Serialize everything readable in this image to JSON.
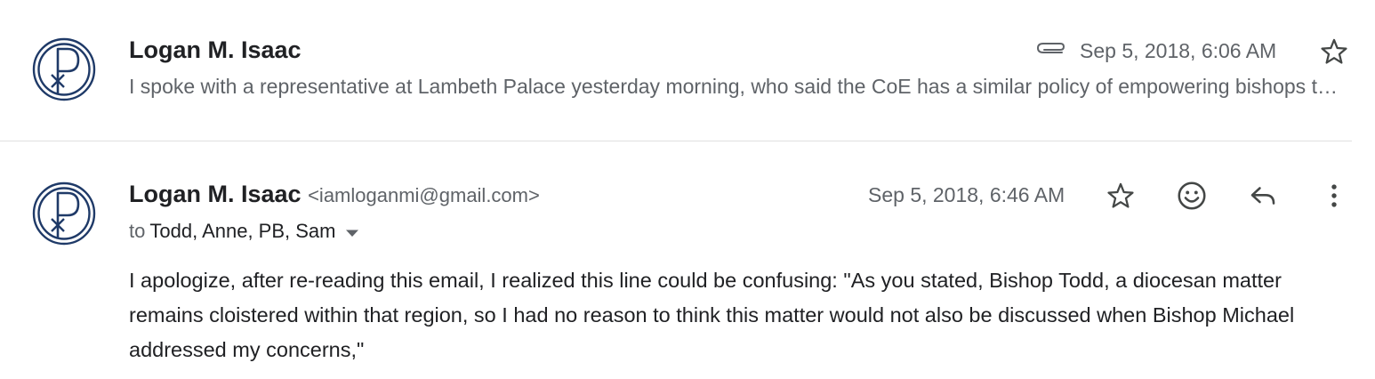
{
  "colors": {
    "avatar_stroke": "#1f3a68",
    "icon": "#5f6368",
    "icon_dark": "#444746"
  },
  "messages": [
    {
      "sender_name": "Logan M. Isaac",
      "snippet": "I spoke with a representative at Lambeth Palace yesterday morning, who said the CoE has a similar policy of empowering bishops to adjudicate matters within their own dioceses",
      "has_attachment": true,
      "date": "Sep 5, 2018, 6:06 AM",
      "icons": [
        "paperclip-icon",
        "star-icon"
      ]
    },
    {
      "sender_name": "Logan M. Isaac",
      "sender_email": "<iamloganmi@gmail.com>",
      "to_label": "to",
      "recipients": "Todd, Anne, PB, Sam",
      "date": "Sep 5, 2018, 6:46 AM",
      "icons": [
        "star-icon",
        "emoji-icon",
        "reply-icon",
        "more-vert-icon",
        "caret-down-icon"
      ],
      "body": "I apologize, after re-reading this email, I realized this line could be confusing: \"As you stated, Bishop Todd, a diocesan matter remains cloistered within that region, so I had no reason to think this matter would not also be discussed when Bishop Michael addressed my concerns,\""
    }
  ]
}
